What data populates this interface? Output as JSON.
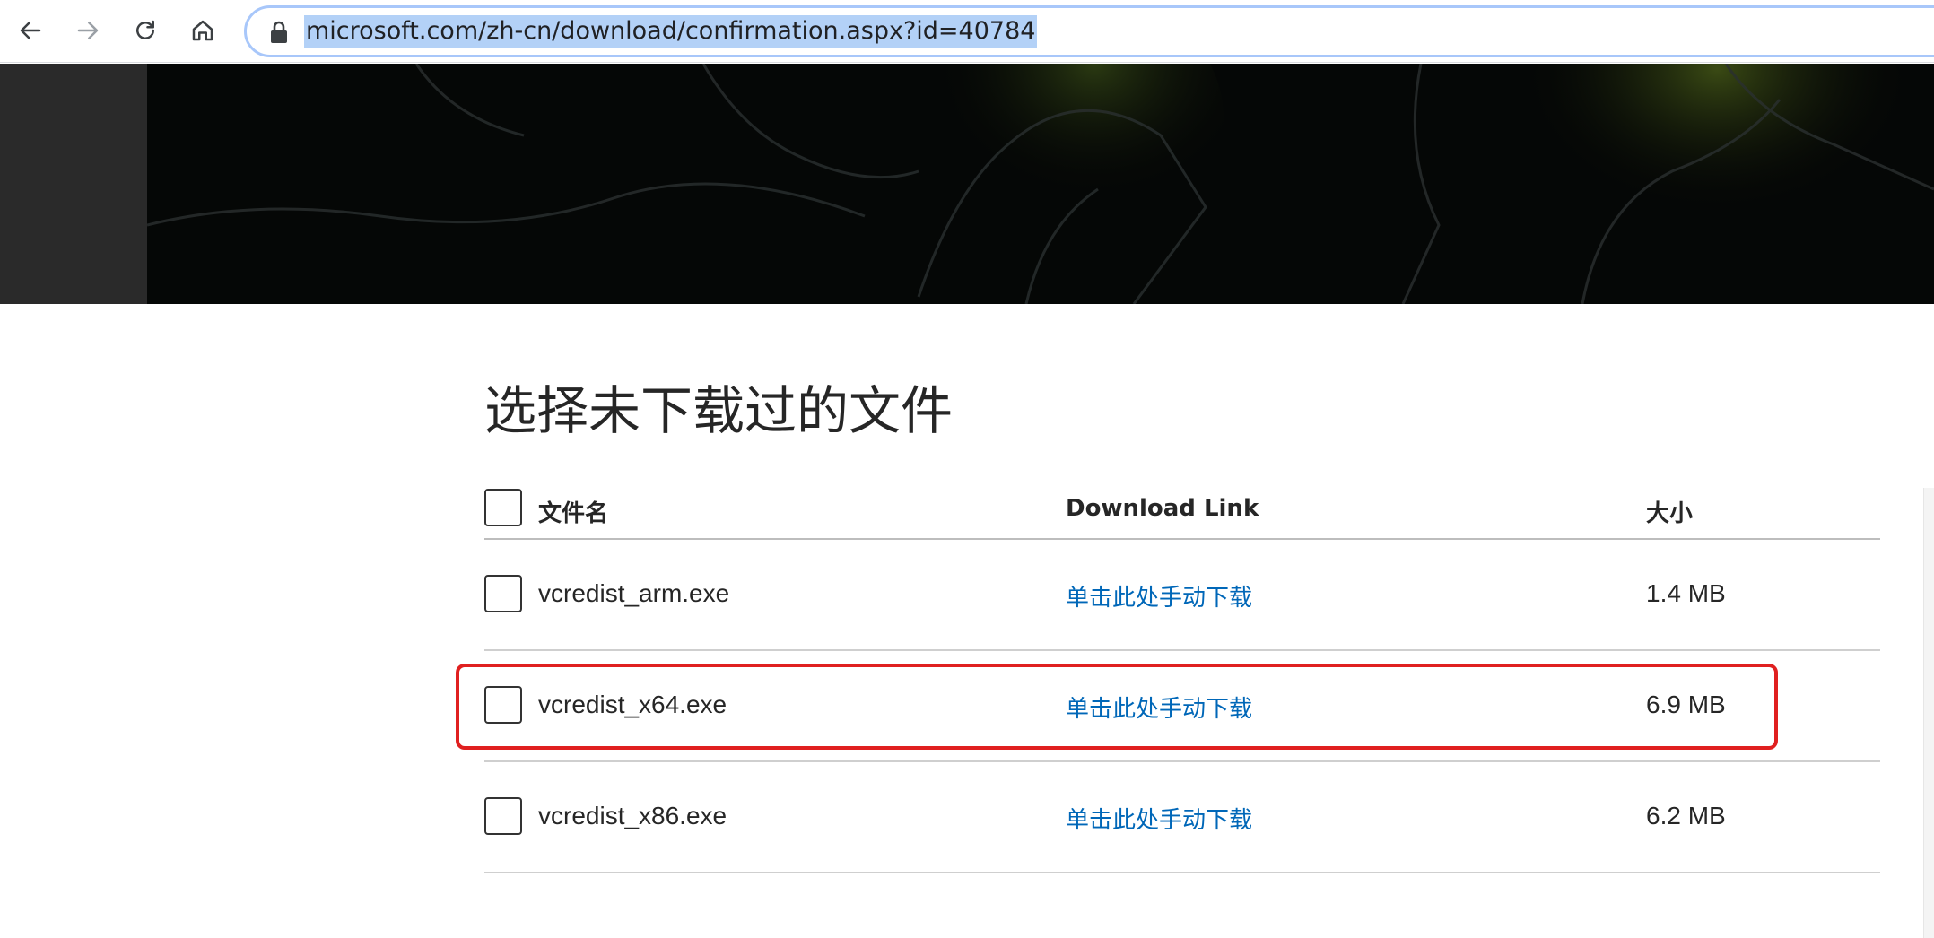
{
  "browser": {
    "url": "microsoft.com/zh-cn/download/confirmation.aspx?id=40784",
    "icons": {
      "back": "arrow-left-icon",
      "forward": "arrow-right-icon",
      "reload": "reload-icon",
      "home": "home-icon",
      "lock": "lock-icon"
    }
  },
  "page": {
    "heading": "选择未下载过的文件"
  },
  "table": {
    "headers": {
      "name": "文件名",
      "link": "Download Link",
      "size": "大小"
    },
    "rows": [
      {
        "name": "vcredist_arm.exe",
        "link": "单击此处手动下载",
        "size": "1.4 MB",
        "checked": false
      },
      {
        "name": "vcredist_x64.exe",
        "link": "单击此处手动下载",
        "size": "6.9 MB",
        "checked": false
      },
      {
        "name": "vcredist_x86.exe",
        "link": "单击此处手动下载",
        "size": "6.2 MB",
        "checked": false
      }
    ]
  },
  "colors": {
    "link": "#0067b8",
    "highlight": "#e02020",
    "url_selection": "#b3d1f7"
  }
}
